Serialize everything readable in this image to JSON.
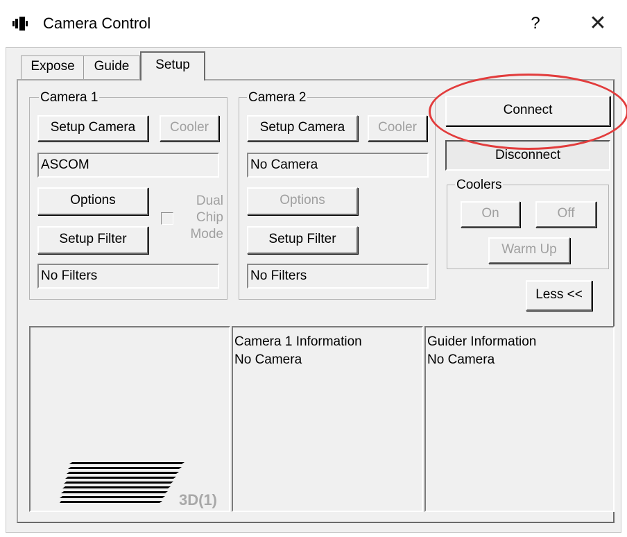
{
  "window": {
    "title": "Camera Control",
    "help_glyph": "?",
    "close_glyph": "✕"
  },
  "tabs": [
    {
      "label": "Expose",
      "active": false
    },
    {
      "label": "Guide",
      "active": false
    },
    {
      "label": "Setup",
      "active": true
    }
  ],
  "camera1": {
    "title": "Camera 1",
    "setup_camera_label": "Setup Camera",
    "cooler_label": "Cooler",
    "camera_value": "ASCOM",
    "options_label": "Options",
    "dual_chip_label_1": "Dual",
    "dual_chip_label_2": "Chip",
    "dual_chip_label_3": "Mode",
    "setup_filter_label": "Setup Filter",
    "filter_value": "No Filters"
  },
  "camera2": {
    "title": "Camera 2",
    "setup_camera_label": "Setup Camera",
    "cooler_label": "Cooler",
    "camera_value": "No Camera",
    "options_label": "Options",
    "setup_filter_label": "Setup Filter",
    "filter_value": "No Filters"
  },
  "connection": {
    "connect_label": "Connect",
    "disconnect_label": "Disconnect"
  },
  "coolers": {
    "title": "Coolers",
    "on_label": "On",
    "off_label": "Off",
    "warm_up_label": "Warm Up"
  },
  "less_label": "Less <<",
  "info": {
    "camera1_heading": "Camera 1 Information",
    "camera1_status": "No Camera",
    "guider_heading": "Guider Information",
    "guider_status": "No Camera"
  },
  "view3d": {
    "label": "3D(1)"
  },
  "annotation": {
    "color": "#e23c3c"
  }
}
